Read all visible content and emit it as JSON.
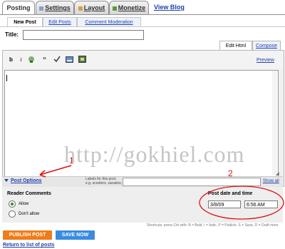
{
  "top_tabs": [
    {
      "label": "Posting",
      "active": true
    },
    {
      "label": "Settings",
      "active": false
    },
    {
      "label": "Layout",
      "active": false
    },
    {
      "label": "Monetize",
      "active": false
    }
  ],
  "view_blog": "View Blog",
  "sub_tabs": [
    {
      "label": "New Post",
      "active": true
    },
    {
      "label": "Edit Posts",
      "active": false
    },
    {
      "label": "Comment Moderation",
      "active": false
    }
  ],
  "title_label": "Title:",
  "editor_tabs": {
    "edit_html": "Edit Html",
    "compose": "Compose"
  },
  "toolbar": {
    "bold": "b",
    "italic": "i",
    "preview": "Preview"
  },
  "watermark": "http://gokhiel.com",
  "annotations": {
    "one": "1",
    "two": "2"
  },
  "post_options": "Post Options",
  "labels": {
    "label": "Labels for this post:",
    "hint": "e.g. scooters, vacation, fall",
    "show_all": "Show all"
  },
  "reader_comments": {
    "title": "Reader Comments",
    "allow": "Allow",
    "dont_allow": "Don't allow"
  },
  "post_date": {
    "title": "Post date and time",
    "date": "3/8/09",
    "time": "6:56 AM"
  },
  "shortcuts": "Shortcuts: press Ctrl with: B = Bold, I = Italic, P = Publish, S = Save, D = Draft more",
  "buttons": {
    "publish": "PUBLISH POST",
    "save": "SAVE NOW"
  },
  "return_link": "Return to list of posts",
  "colors": {
    "link": "#1f40b0",
    "publish": "#f07c1a",
    "save": "#3a8be0",
    "annotation": "#e01010",
    "radio_selected": "#1a8f2a"
  }
}
